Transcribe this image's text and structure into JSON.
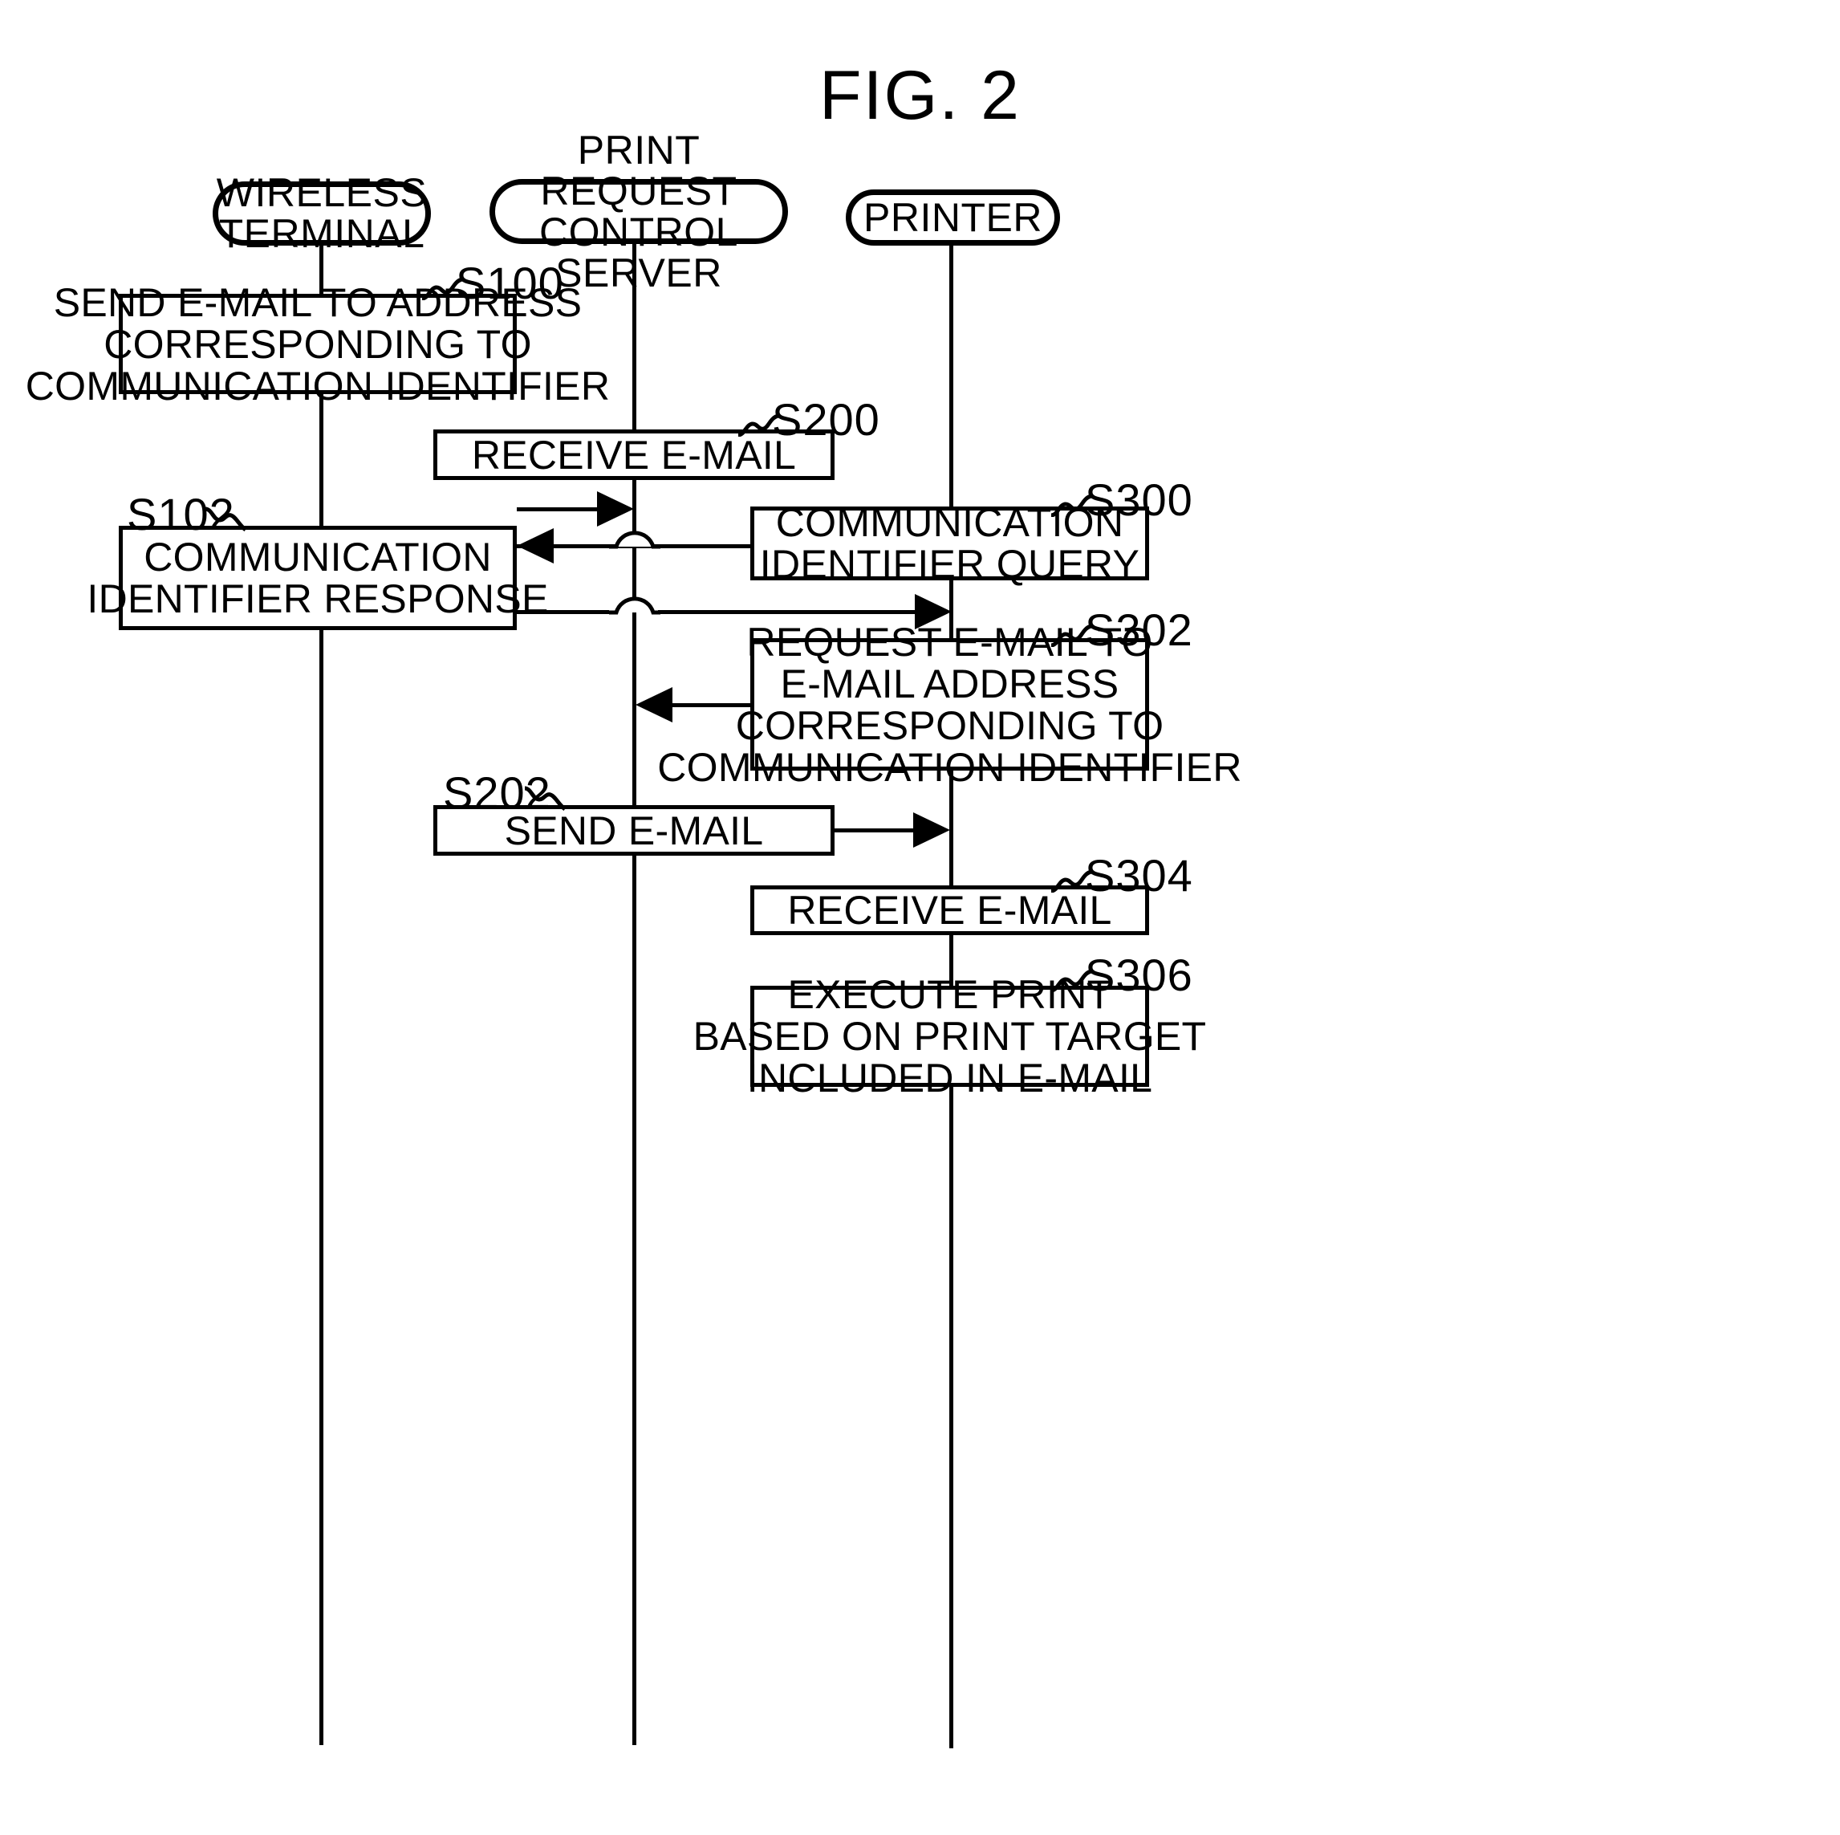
{
  "figure": {
    "title": "FIG. 2",
    "type": "sequence-diagram"
  },
  "lanes": [
    {
      "id": "wireless-terminal",
      "label_line1": "WIRELESS",
      "label_line2": "TERMINAL"
    },
    {
      "id": "print-request-control-server",
      "label_line1": "PRINT REQUEST",
      "label_line2": "CONTROL SERVER"
    },
    {
      "id": "printer",
      "label_line1": "PRINTER",
      "label_line2": ""
    }
  ],
  "steps": [
    {
      "ref": "S100",
      "lane": "wireless-terminal",
      "lines": [
        "SEND E-MAIL TO ADDRESS",
        "CORRESPONDING TO",
        "COMMUNICATION IDENTIFIER"
      ]
    },
    {
      "ref": "S200",
      "lane": "print-request-control-server",
      "lines": [
        "RECEIVE E-MAIL"
      ]
    },
    {
      "ref": "S300",
      "lane": "printer",
      "lines": [
        "COMMUNICATION",
        "IDENTIFIER QUERY"
      ]
    },
    {
      "ref": "S102",
      "lane": "wireless-terminal",
      "lines": [
        "COMMUNICATION",
        "IDENTIFIER RESPONSE"
      ]
    },
    {
      "ref": "S302",
      "lane": "printer",
      "lines": [
        "REQUEST E-MAIL TO",
        "E-MAIL ADDRESS",
        "CORRESPONDING TO",
        "COMMUNICATION IDENTIFIER"
      ]
    },
    {
      "ref": "S202",
      "lane": "print-request-control-server",
      "lines": [
        "SEND E-MAIL"
      ]
    },
    {
      "ref": "S304",
      "lane": "printer",
      "lines": [
        "RECEIVE E-MAIL"
      ]
    },
    {
      "ref": "S306",
      "lane": "printer",
      "lines": [
        "EXECUTE PRINT",
        "BASED ON PRINT TARGET",
        "INCLUDED IN E-MAIL"
      ]
    }
  ],
  "messages": [
    {
      "id": "s100-to-server",
      "from": "wireless-terminal",
      "to": "print-request-control-server",
      "direction": "right"
    },
    {
      "id": "s300-query-to-terminal",
      "from": "printer",
      "to": "wireless-terminal",
      "direction": "left"
    },
    {
      "id": "s102-response-to-printer",
      "from": "wireless-terminal",
      "to": "printer",
      "direction": "right"
    },
    {
      "id": "s302-request-to-server",
      "from": "printer",
      "to": "print-request-control-server",
      "direction": "left"
    },
    {
      "id": "s202-send-to-printer",
      "from": "print-request-control-server",
      "to": "printer",
      "direction": "right"
    }
  ],
  "colors": {
    "ink": "#000000",
    "paper": "#ffffff"
  }
}
